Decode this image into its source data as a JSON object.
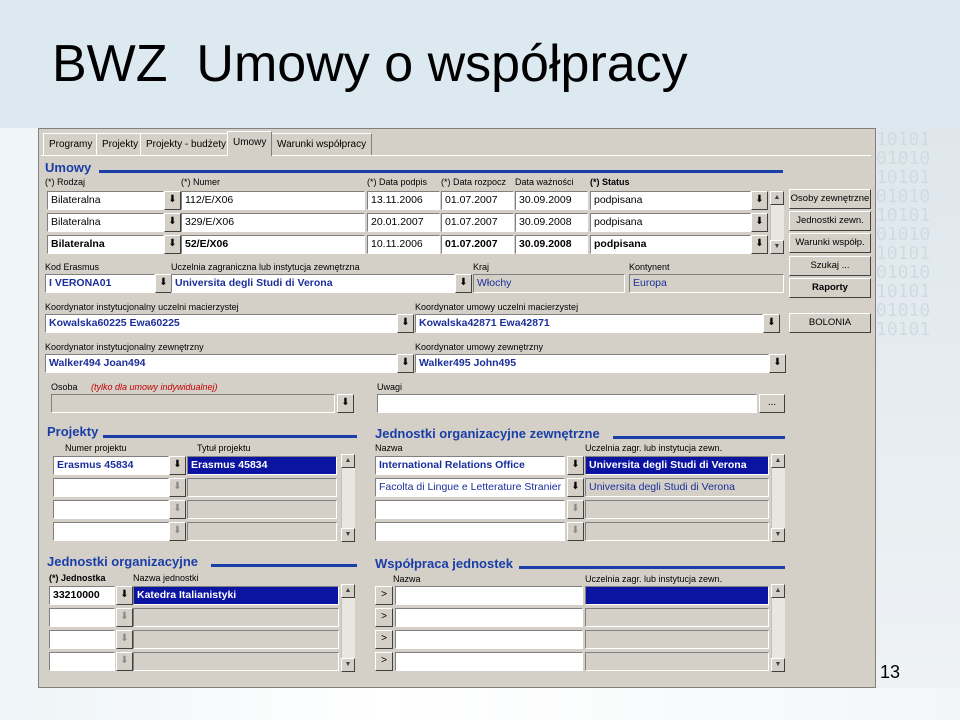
{
  "slide": {
    "title": "BWZ  Umowy o współpracy",
    "page_number": "13"
  },
  "tabs": [
    "Programy",
    "Projekty",
    "Projekty - budżety",
    "Umowy",
    "Warunki współpracy"
  ],
  "umowy": {
    "title": "Umowy",
    "headers": {
      "rodzaj": "(*) Rodzaj",
      "numer": "(*) Numer",
      "data_podpis": "(*) Data podpis",
      "data_rozpocz": "(*) Data rozpocz",
      "data_waznosci": "Data ważności",
      "status": "(*) Status"
    },
    "rows": [
      {
        "rodzaj": "Bilateralna",
        "numer": "112/E/X06",
        "data_podpis": "13.11.2006",
        "data_rozpocz": "01.07.2007",
        "data_waznosci": "30.09.2009",
        "status": "podpisana"
      },
      {
        "rodzaj": "Bilateralna",
        "numer": "329/E/X06",
        "data_podpis": "20.01.2007",
        "data_rozpocz": "01.07.2007",
        "data_waznosci": "30.09.2008",
        "status": "podpisana"
      },
      {
        "rodzaj": "Bilateralna",
        "numer": "52/E/X06",
        "data_podpis": "10.11.2006",
        "data_rozpocz": "01.07.2007",
        "data_waznosci": "30.09.2008",
        "status": "podpisana"
      }
    ]
  },
  "side_buttons": [
    "Osoby zewnętrzne",
    "Jednostki zewn.",
    "Warunki współp.",
    "Szukaj ...",
    "Raporty",
    "BOLONIA"
  ],
  "kod_erasmus": {
    "label": "Kod Erasmus",
    "value": "I  VERONA01"
  },
  "uczelnia": {
    "label": "Uczelnia zagraniczna lub instytucja zewnętrzna",
    "value": "Universita degli Studi di Verona"
  },
  "kraj": {
    "label": "Kraj",
    "value": "Włochy"
  },
  "kontynent": {
    "label": "Kontynent",
    "value": "Europa"
  },
  "koord_inst_macierzystej": {
    "label": "Koordynator instytucjonalny uczelni macierzystej",
    "value": "Kowalska60225 Ewa60225"
  },
  "koord_umowy_macierzystej": {
    "label": "Koordynator umowy uczelni macierzystej",
    "value": "Kowalska42871 Ewa42871"
  },
  "koord_inst_zewnetrzny": {
    "label": "Koordynator instytucjonalny zewnętrzny",
    "value": "Walker494 Joan494"
  },
  "koord_umowy_zewnetrzny": {
    "label": "Koordynator umowy zewnętrzny",
    "value": "Walker495 John495"
  },
  "osoba": {
    "label": "Osoba",
    "note": "(tylko dla umowy indywidualnej)",
    "value": ""
  },
  "uwagi": {
    "label": "Uwagi",
    "value": "",
    "button": "..."
  },
  "projekty": {
    "title": "Projekty",
    "col_numer": "Numer projektu",
    "col_tytul": "Tytuł projektu",
    "rows": [
      {
        "numer": "Erasmus 45834",
        "tytul": "Erasmus 45834"
      }
    ]
  },
  "jednostki_zewn": {
    "title": "Jednostki organizacyjne zewnętrzne",
    "col_nazwa": "Nazwa",
    "col_uczelnia": "Uczelnia zagr. lub instytucja zewn.",
    "rows": [
      {
        "nazwa": "International Relations Office",
        "uczelnia": "Universita degli Studi di Verona"
      },
      {
        "nazwa": "Facolta di Lingue e Letterature Stranier",
        "uczelnia": "Universita degli Studi di Verona"
      }
    ]
  },
  "jednostki_org": {
    "title": "Jednostki organizacyjne",
    "col_nr": "(*) Jednostka",
    "col_nazwa": "Nazwa jednostki",
    "rows": [
      {
        "nr": "33210000",
        "nazwa": "Katedra Italianistyki"
      }
    ]
  },
  "wspolpraca": {
    "title": "Współpraca jednostek",
    "col_nazwa": "Nazwa",
    "col_uczelnia": "Uczelnia zagr. lub instytucja zewn."
  },
  "icons": {
    "dropdown": "arrow-down-icon",
    "goto": "chevron-right-icon",
    "scroll_up": "scroll-up-icon",
    "scroll_down": "scroll-down-icon"
  }
}
